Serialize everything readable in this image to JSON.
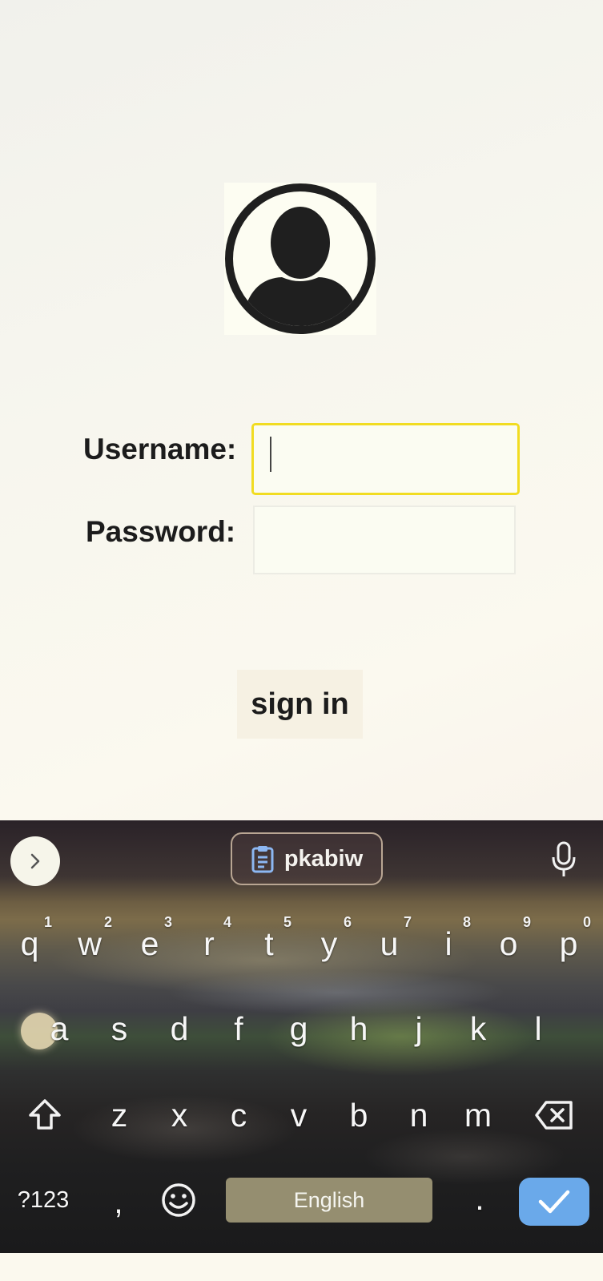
{
  "form": {
    "username_label": "Username:",
    "password_label": "Password:",
    "username_value": "",
    "password_value": "",
    "signin_label": "sign in"
  },
  "keyboard": {
    "clipboard_text": "pkabiw",
    "row1": [
      {
        "k": "q",
        "h": "1"
      },
      {
        "k": "w",
        "h": "2"
      },
      {
        "k": "e",
        "h": "3"
      },
      {
        "k": "r",
        "h": "4"
      },
      {
        "k": "t",
        "h": "5"
      },
      {
        "k": "y",
        "h": "6"
      },
      {
        "k": "u",
        "h": "7"
      },
      {
        "k": "i",
        "h": "8"
      },
      {
        "k": "o",
        "h": "9"
      },
      {
        "k": "p",
        "h": "0"
      }
    ],
    "row2": [
      "a",
      "s",
      "d",
      "f",
      "g",
      "h",
      "j",
      "k",
      "l"
    ],
    "row3": [
      "z",
      "x",
      "c",
      "v",
      "b",
      "n",
      "m"
    ],
    "symbols_label": "?123",
    "comma": ",",
    "space_label": "English",
    "period": ".",
    "colors": {
      "enter": "#6aa9ea",
      "focus_border": "#f1dc22"
    }
  },
  "icons": [
    "avatar-icon",
    "expand-chevron-icon",
    "clipboard-icon",
    "microphone-icon",
    "shift-icon",
    "backspace-icon",
    "emoji-icon",
    "checkmark-icon"
  ]
}
